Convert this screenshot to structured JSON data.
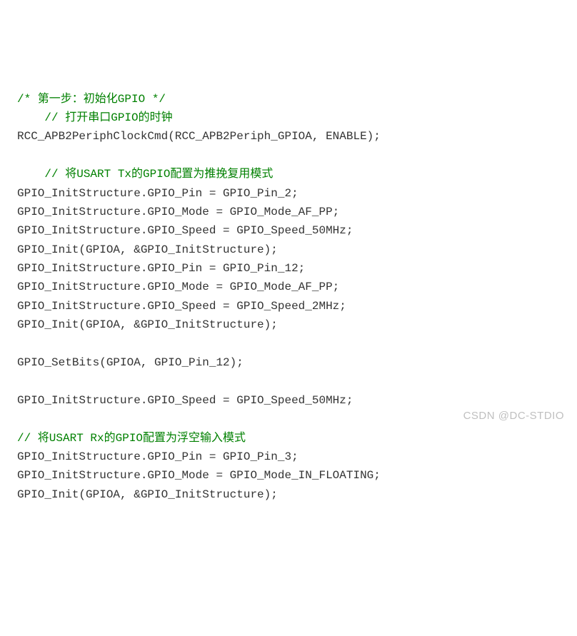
{
  "lines": [
    {
      "cls": "comment",
      "text": "/* 第一步：初始化GPIO */"
    },
    {
      "cls": "comment",
      "text": "    // 打开串口GPIO的时钟"
    },
    {
      "cls": "code",
      "text": "RCC_APB2PeriphClockCmd(RCC_APB2Periph_GPIOA, ENABLE);"
    },
    {
      "cls": "code",
      "text": ""
    },
    {
      "cls": "comment",
      "text": "    // 将USART Tx的GPIO配置为推挽复用模式"
    },
    {
      "cls": "code",
      "text": "GPIO_InitStructure.GPIO_Pin = GPIO_Pin_2;"
    },
    {
      "cls": "code",
      "text": "GPIO_InitStructure.GPIO_Mode = GPIO_Mode_AF_PP;"
    },
    {
      "cls": "code",
      "text": "GPIO_InitStructure.GPIO_Speed = GPIO_Speed_50MHz;"
    },
    {
      "cls": "code",
      "text": "GPIO_Init(GPIOA, &GPIO_InitStructure);"
    },
    {
      "cls": "code",
      "text": "GPIO_InitStructure.GPIO_Pin = GPIO_Pin_12;"
    },
    {
      "cls": "code",
      "text": "GPIO_InitStructure.GPIO_Mode = GPIO_Mode_AF_PP;"
    },
    {
      "cls": "code",
      "text": "GPIO_InitStructure.GPIO_Speed = GPIO_Speed_2MHz;"
    },
    {
      "cls": "code",
      "text": "GPIO_Init(GPIOA, &GPIO_InitStructure);"
    },
    {
      "cls": "code",
      "text": ""
    },
    {
      "cls": "code",
      "text": "GPIO_SetBits(GPIOA, GPIO_Pin_12);"
    },
    {
      "cls": "code",
      "text": ""
    },
    {
      "cls": "code",
      "text": "GPIO_InitStructure.GPIO_Speed = GPIO_Speed_50MHz;"
    },
    {
      "cls": "code",
      "text": ""
    },
    {
      "cls": "comment",
      "text": "// 将USART Rx的GPIO配置为浮空输入模式"
    },
    {
      "cls": "code",
      "text": "GPIO_InitStructure.GPIO_Pin = GPIO_Pin_3;"
    },
    {
      "cls": "code",
      "text": "GPIO_InitStructure.GPIO_Mode = GPIO_Mode_IN_FLOATING;"
    },
    {
      "cls": "code",
      "text": "GPIO_Init(GPIOA, &GPIO_InitStructure);"
    }
  ],
  "watermark": "CSDN @DC-STDIO"
}
